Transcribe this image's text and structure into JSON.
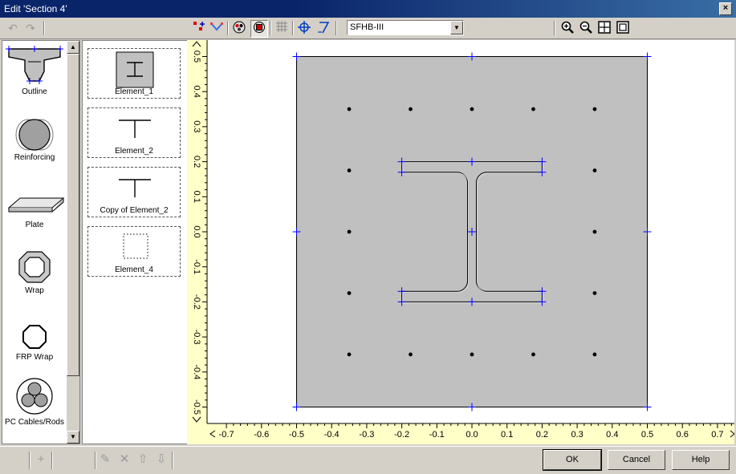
{
  "window": {
    "title": "Edit 'Section 4'",
    "close_glyph": "×"
  },
  "toolbar": {
    "undo_icon": "undo-icon",
    "redo_icon": "redo-icon",
    "add_points_icon": "add-points-icon",
    "select_icon": "select-icon",
    "view_icon": "view-mode-icon",
    "render_icon": "render-mode-icon",
    "grid_icon": "grid-icon",
    "center_icon": "center-icon",
    "measure_icon": "measure-icon",
    "material_value": "SFHB-III",
    "zoom_in_icon": "zoom-in-icon",
    "zoom_out_icon": "zoom-out-icon",
    "zoom_fit_icon": "zoom-fit-icon",
    "zoom_window_icon": "zoom-window-icon"
  },
  "palette": {
    "items": [
      {
        "label": "Outline",
        "icon": "outline-icon"
      },
      {
        "label": "Reinforcing",
        "icon": "reinforcing-icon"
      },
      {
        "label": "Plate",
        "icon": "plate-icon"
      },
      {
        "label": "Wrap",
        "icon": "wrap-icon"
      },
      {
        "label": "FRP Wrap",
        "icon": "frp-wrap-icon"
      },
      {
        "label": "PC Cables/Rods",
        "icon": "pc-cables-icon"
      }
    ]
  },
  "elements": {
    "items": [
      {
        "label": "Element_1",
        "selected": true
      },
      {
        "label": "Element_2",
        "selected": false
      },
      {
        "label": "Copy of Element_2",
        "selected": false
      },
      {
        "label": "Element_4",
        "selected": false
      }
    ]
  },
  "plot": {
    "x_ticks": [
      "-0.7",
      "-0.6",
      "-0.5",
      "-0.4",
      "-0.3",
      "-0.2",
      "-0.1",
      "0.0",
      "0.1",
      "0.2",
      "0.3",
      "0.4",
      "0.5",
      "0.6",
      "0.7"
    ],
    "y_ticks": [
      "0.5",
      "0.4",
      "0.3",
      "0.2",
      "0.1",
      "0.0",
      "-0.1",
      "-0.2",
      "-0.3",
      "-0.4",
      "-0.5"
    ],
    "x_range": [
      -0.7,
      0.7
    ],
    "y_range": [
      -0.5,
      0.5
    ],
    "section_square": {
      "half_width": 0.5,
      "fill": "#c0c0c0"
    },
    "ibeam": {
      "flange_half_width": 0.2,
      "flange_top": 0.2,
      "flange_thickness": 0.03,
      "web_half_thickness": 0.0125,
      "fillet_radius": 0.03
    },
    "rebars": [
      [
        -0.35,
        0.35
      ],
      [
        -0.175,
        0.35
      ],
      [
        0.0,
        0.35
      ],
      [
        0.175,
        0.35
      ],
      [
        0.35,
        0.35
      ],
      [
        -0.35,
        0.175
      ],
      [
        0.35,
        0.175
      ],
      [
        -0.35,
        0.0
      ],
      [
        0.35,
        0.0
      ],
      [
        -0.35,
        -0.175
      ],
      [
        0.35,
        -0.175
      ],
      [
        -0.35,
        -0.35
      ],
      [
        -0.175,
        -0.35
      ],
      [
        0.0,
        -0.35
      ],
      [
        0.175,
        -0.35
      ],
      [
        0.35,
        -0.35
      ]
    ],
    "colors": {
      "axis_bg": "#ffffc8",
      "control_points": "#0000ff",
      "ibeam_stroke": "#000000"
    }
  },
  "footer": {
    "ok_label": "OK",
    "cancel_label": "Cancel",
    "help_label": "Help",
    "add_icon": "plus-icon",
    "edit_icon": "edit-icon",
    "delete_icon": "delete-icon",
    "up_icon": "arrow-up-icon",
    "down_icon": "arrow-down-icon"
  }
}
